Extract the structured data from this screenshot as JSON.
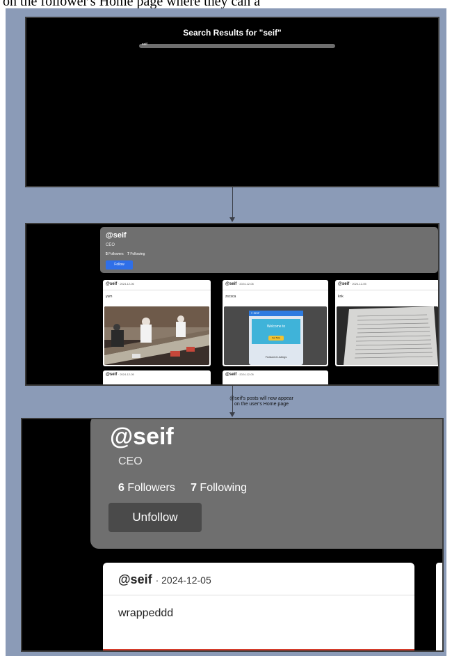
{
  "doc_top_text": "on the follower's Home page where they can a",
  "search_panel": {
    "title": "Search Results for \"seif\"",
    "query": "seif"
  },
  "profile_small": {
    "handle": "@seif",
    "role": "CEO",
    "followers_count": "5",
    "followers_label": "Followers",
    "following_count": "7",
    "following_label": "Following",
    "follow_button": "Follow",
    "posts": [
      {
        "handle": "@seif",
        "date": "· 2024-12-06",
        "caption": "yum"
      },
      {
        "handle": "@seif",
        "date": "· 2024-12-06",
        "caption": "zscsca"
      },
      {
        "handle": "@seif",
        "date": "· 2024-12-05",
        "caption": "knk"
      },
      {
        "handle": "@seif",
        "date": "· 2024-12-05",
        "caption": ""
      },
      {
        "handle": "@seif",
        "date": "· 2024-12-05",
        "caption": ""
      }
    ],
    "post2_image_text": {
      "header": "≡ SEIF",
      "welcome": "Welcome to",
      "button": "Get Now",
      "footer": "Featured Listings"
    }
  },
  "annotation": "@seif's posts will now appear on the user's Home page",
  "profile_large": {
    "handle": "@seif",
    "role": "CEO",
    "followers_count": "6",
    "followers_label": "Followers",
    "following_count": "7",
    "following_label": "Following",
    "unfollow_button": "Unfollow",
    "post": {
      "handle": "@seif",
      "date": "· 2024-12-05",
      "caption": "wrappeddd"
    }
  },
  "colors": {
    "figure_bg": "#8b9bb7",
    "panel_bg": "#000000",
    "profile_card_bg": "#6f6f6f",
    "follow_button": "#2f6fe8",
    "unfollow_button": "#4a4a4a"
  }
}
